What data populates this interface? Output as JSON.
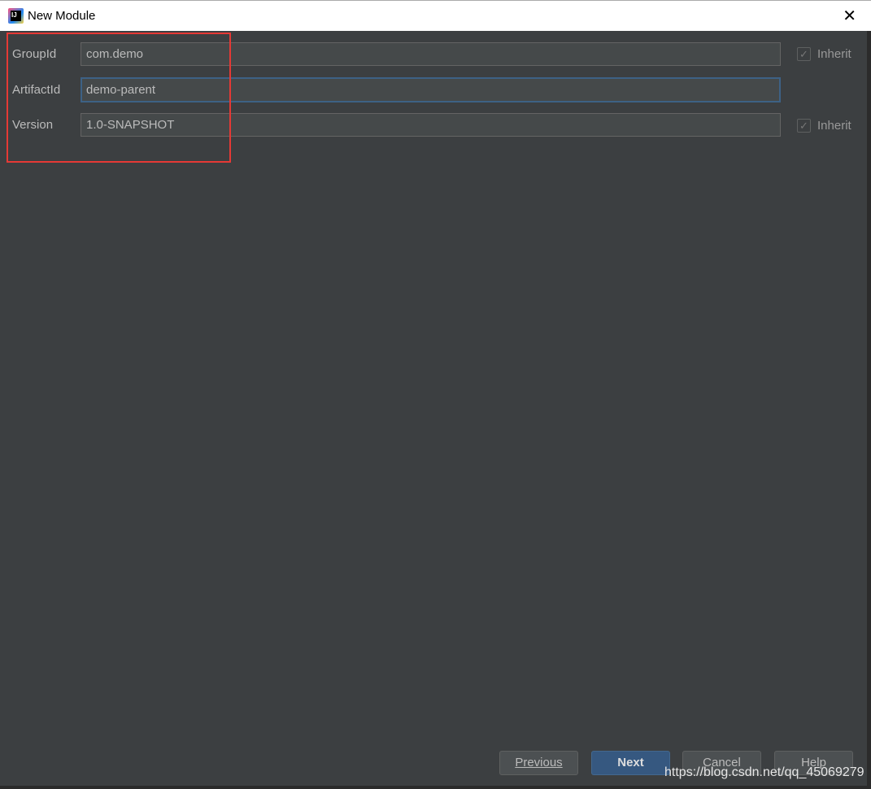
{
  "window": {
    "title": "New Module",
    "app_icon_text": "IJ"
  },
  "fields": [
    {
      "label": "GroupId",
      "value": "com.demo",
      "inherit": true
    },
    {
      "label": "ArtifactId",
      "value": "demo-parent"
    },
    {
      "label": "Version",
      "value": "1.0-SNAPSHOT",
      "inherit": true
    }
  ],
  "inherit_label": "Inherit",
  "check": "✓",
  "buttons": {
    "previous": "Previous",
    "next": "Next",
    "cancel": "Cancel",
    "help": "Help"
  },
  "watermark": "https://blog.csdn.net/qq_45069279",
  "colors": {
    "highlight": "#e53935",
    "primary": "#365880",
    "background": "#3c3f41"
  }
}
